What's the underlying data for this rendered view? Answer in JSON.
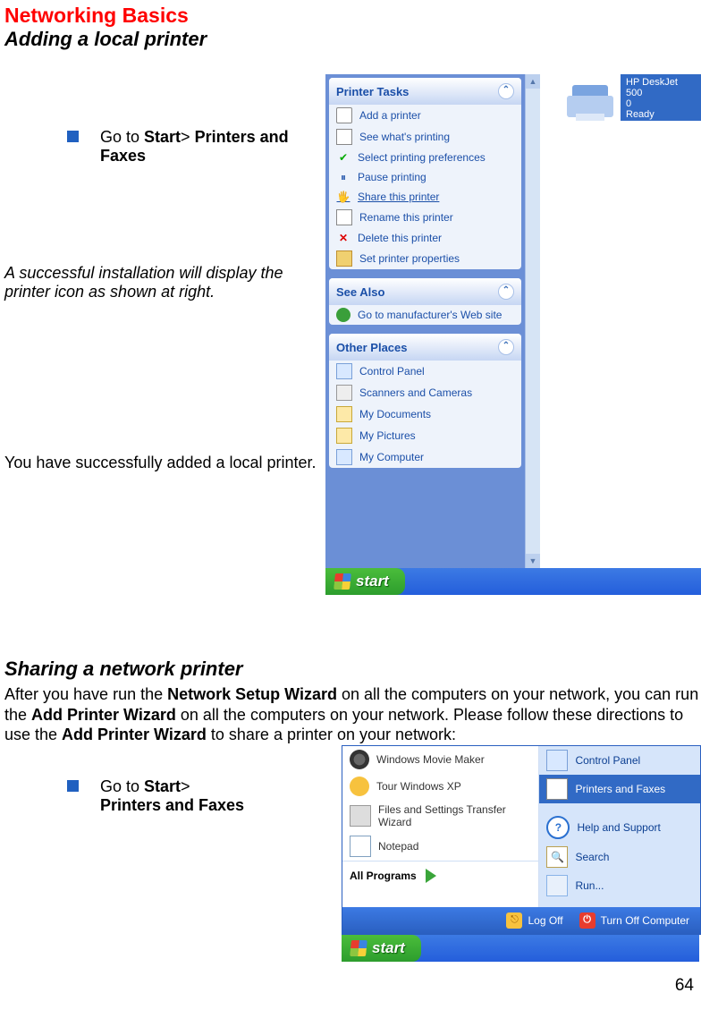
{
  "header": {
    "title": "Networking Basics",
    "subtitle": "Adding a local printer"
  },
  "bullet1": {
    "pre": "Go to ",
    "b1": "Start",
    "mid": "> ",
    "b2": "Printers and Faxes"
  },
  "note_italic": "A successful installation will display the printer icon as shown at right.",
  "note_body": "You have successfully added a local printer.",
  "xp": {
    "printer_name": "HP DeskJet 500",
    "printer_sub": "0",
    "printer_status": "Ready",
    "tasks_header": "Printer Tasks",
    "tasks": {
      "add": "Add a printer",
      "seewhat": "See what's printing",
      "selectpref": "Select printing preferences",
      "pause": "Pause printing",
      "share": "Share this printer",
      "rename": "Rename this printer",
      "delete": "Delete this printer",
      "setprops": "Set printer properties"
    },
    "seealso_header": "See Also",
    "seealso_item": "Go to manufacturer's Web site",
    "other_header": "Other Places",
    "other": {
      "cp": "Control Panel",
      "scanners": "Scanners and Cameras",
      "mydocs": "My Documents",
      "mypics": "My Pictures",
      "mycomp": "My Computer"
    },
    "start_label": "start"
  },
  "section2": {
    "header": "Sharing a network printer",
    "body_pre": "After you have run the ",
    "b1": "Network Setup Wizard",
    "body_mid1": " on all the computers on your network, you can run the ",
    "b2": "Add Printer Wizard",
    "body_mid2": " on all the computers on your network.  Please follow these directions to use the ",
    "b3": "Add Printer Wizard",
    "body_end": " to share a printer on your network:"
  },
  "bullet2": {
    "pre": "Go to ",
    "b1": "Start",
    "mid": ">",
    "b2": "Printers and Faxes"
  },
  "startmenu": {
    "left": {
      "movie": "Windows Movie Maker",
      "tour": "Tour Windows XP",
      "wizard": "Files and Settings Transfer Wizard",
      "notepad": "Notepad",
      "allprograms": "All Programs"
    },
    "right": {
      "cp": "Control Panel",
      "pf": "Printers and Faxes",
      "help": "Help and Support",
      "search": "Search",
      "run": "Run..."
    },
    "footer": {
      "logoff": "Log Off",
      "turnoff": "Turn Off Computer"
    },
    "start_label": "start"
  },
  "page_number": "64"
}
